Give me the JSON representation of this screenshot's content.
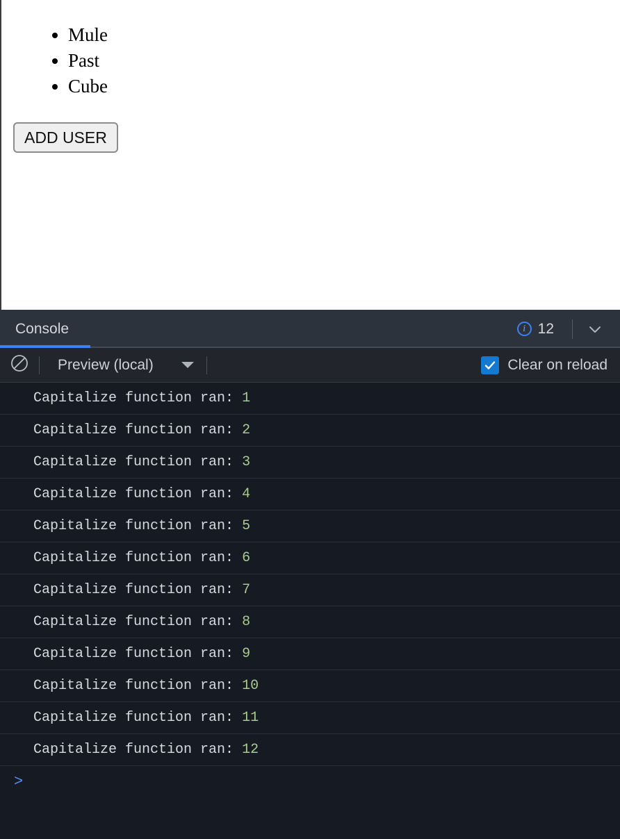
{
  "preview": {
    "users": [
      "Mule",
      "Past",
      "Cube"
    ],
    "add_user_label": "ADD USER"
  },
  "console": {
    "tab_label": "Console",
    "info_count": "12",
    "info_icon": "info-circle-icon",
    "collapse_icon": "chevron-down-icon",
    "clear_icon": "clear-console-icon",
    "source_label": "Preview (local)",
    "source_caret_icon": "caret-down-icon",
    "clear_on_reload_label": "Clear on reload",
    "clear_on_reload_checked": true,
    "prompt_symbol": ">",
    "accent_blue": "#3b82f6",
    "checkbox_blue": "#1479d1",
    "value_green": "#a8cc8c",
    "logs": [
      {
        "message": "Capitalize function ran: ",
        "value": "1"
      },
      {
        "message": "Capitalize function ran: ",
        "value": "2"
      },
      {
        "message": "Capitalize function ran: ",
        "value": "3"
      },
      {
        "message": "Capitalize function ran: ",
        "value": "4"
      },
      {
        "message": "Capitalize function ran: ",
        "value": "5"
      },
      {
        "message": "Capitalize function ran: ",
        "value": "6"
      },
      {
        "message": "Capitalize function ran: ",
        "value": "7"
      },
      {
        "message": "Capitalize function ran: ",
        "value": "8"
      },
      {
        "message": "Capitalize function ran: ",
        "value": "9"
      },
      {
        "message": "Capitalize function ran: ",
        "value": "10"
      },
      {
        "message": "Capitalize function ran: ",
        "value": "11"
      },
      {
        "message": "Capitalize function ran: ",
        "value": "12"
      }
    ]
  }
}
